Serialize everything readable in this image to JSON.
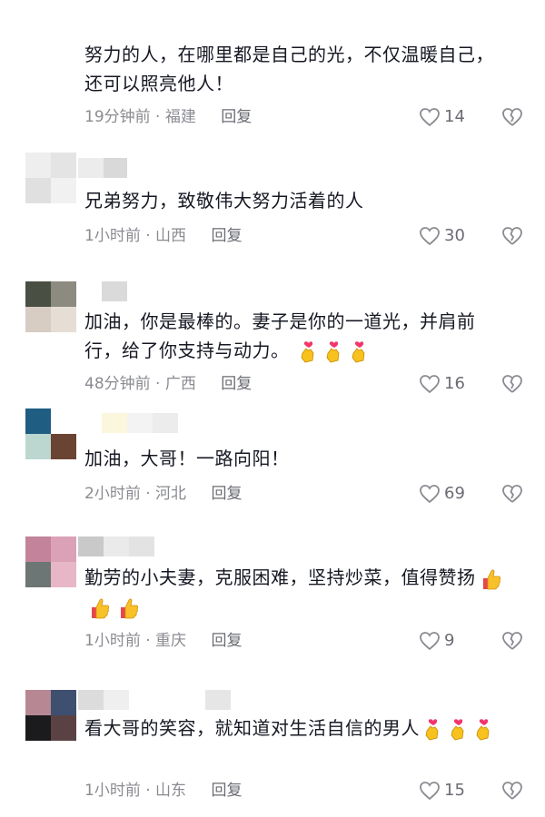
{
  "comments": [
    {
      "text": "努力的人，在哪里都是自己的光，不仅温暖自己，还可以照亮他人！",
      "time": "19分钟前",
      "region": "福建",
      "reply": "回复",
      "likes": "14"
    },
    {
      "text": "兄弟努力，致敬伟大努力活着的人",
      "time": "1小时前",
      "region": "山西",
      "reply": "回复",
      "likes": "30"
    },
    {
      "text": "加油，你是最棒的。妻子是你的一道光，并肩前行，给了你支持与动力。",
      "emoji": "hand-heart-emoji",
      "emoji_count": 3,
      "time": "48分钟前",
      "region": "广西",
      "reply": "回复",
      "likes": "16"
    },
    {
      "text": "加油，大哥！一路向阳！",
      "time": "2小时前",
      "region": "河北",
      "reply": "回复",
      "likes": "69"
    },
    {
      "text": "勤劳的小夫妻，克服困难，坚持炒菜，值得赞扬",
      "emoji": "thumbs-up-emoji",
      "emoji_count": 3,
      "time": "1小时前",
      "region": "重庆",
      "reply": "回复",
      "likes": "9"
    },
    {
      "text": "看大哥的笑容，就知道对生活自信的男人",
      "emoji": "hand-heart-emoji",
      "emoji_count": 3,
      "time": "1小时前",
      "region": "山东",
      "reply": "回复",
      "likes": "15"
    }
  ],
  "separator": " · ",
  "colors": {
    "text": "#161823",
    "meta": "#8a8b91",
    "icon": "#8a8b91"
  }
}
